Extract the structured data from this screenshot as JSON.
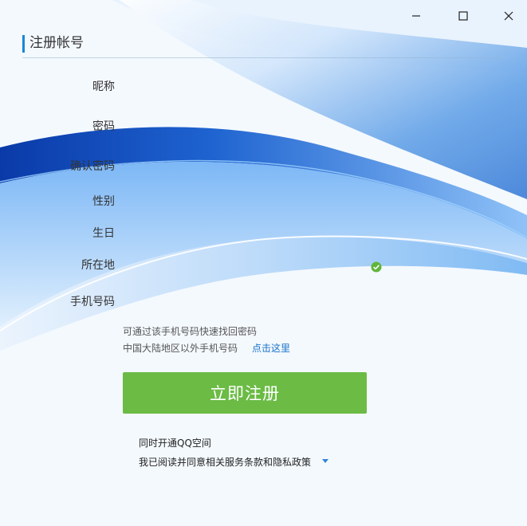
{
  "window": {
    "title": "注册帐号",
    "controls": [
      "minimize-icon",
      "maximize-icon",
      "close-icon"
    ]
  },
  "form": {
    "labels": {
      "nickname": "昵称",
      "password": "密码",
      "confirm_password": "确认密码",
      "gender": "性别",
      "birthday": "生日",
      "location": "所在地",
      "phone": "手机号码"
    },
    "location_status_icon": "check-circle-icon"
  },
  "phone_hint": {
    "line1": "可通过该手机号码快速找回密码",
    "line2": "中国大陆地区以外手机号码",
    "link": "点击这里"
  },
  "register_button": "立即注册",
  "options": {
    "open_qzone": "同时开通QQ空间",
    "agreement": "我已阅读并同意相关服务条款和隐私政策",
    "agreement_icon": "dropdown-arrow-icon"
  },
  "colors": {
    "accent": "#1a86d6",
    "button": "#6bbb45",
    "link": "#1a73c8",
    "background": "#f4f9fe"
  }
}
